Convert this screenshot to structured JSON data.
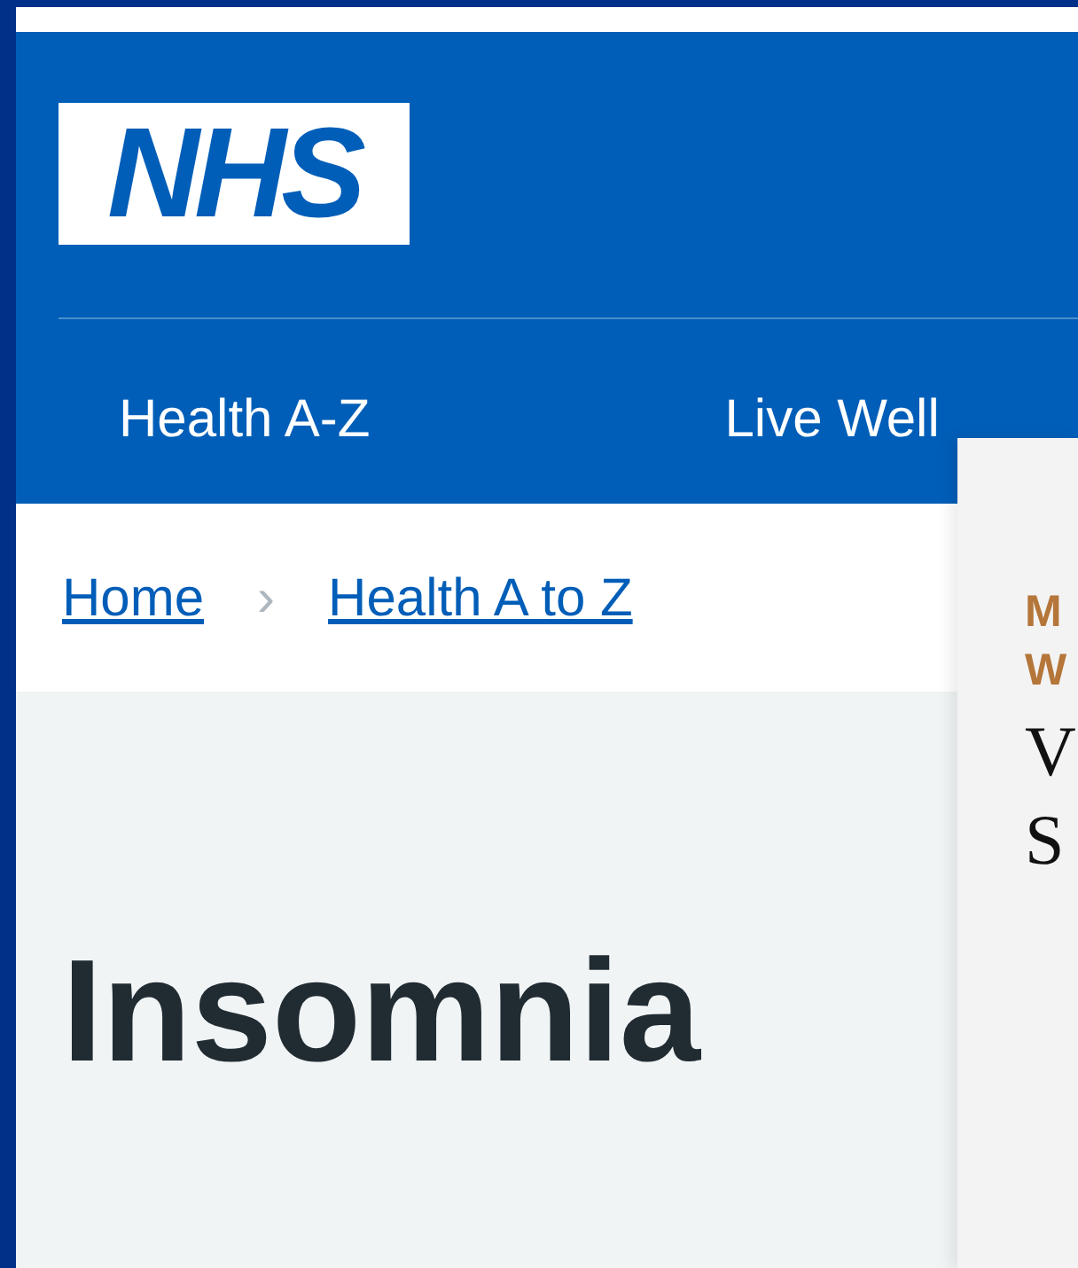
{
  "header": {
    "logo": "NHS",
    "nav": [
      {
        "label": "Health A-Z"
      },
      {
        "label": "Live Well"
      }
    ]
  },
  "breadcrumb": {
    "items": [
      {
        "label": "Home"
      },
      {
        "label": "Health A to Z"
      }
    ],
    "separator": "›"
  },
  "page_title": "Insomnia",
  "overlay": {
    "kicker_lines": [
      "M",
      "W"
    ],
    "title_lines": [
      "V",
      "S"
    ]
  }
}
